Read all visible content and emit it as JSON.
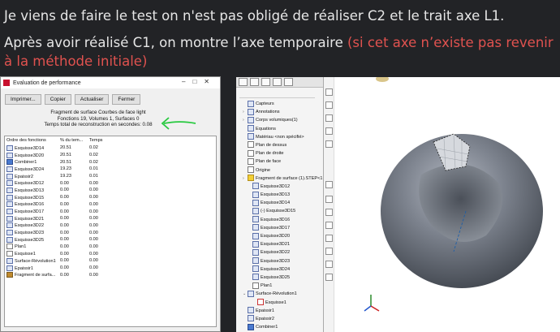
{
  "text": {
    "line1": "Je viens de faire le test on n'est pas obligé de réaliser C2 et le trait axe L1.",
    "line2_prefix": "Après avoir réalisé C1, on montre l’axe temporaire ",
    "line2_red": "(si cet axe n’existe pas revenir à la méthode initiale)"
  },
  "colors": {
    "background": "#222326",
    "red_text": "#e0524f",
    "surface": "#6d7480"
  },
  "perf_window": {
    "title": "Evaluation de performance",
    "buttons": [
      "Imprimer...",
      "Copier",
      "Actualiser",
      "Fermer"
    ],
    "info": [
      "Fragment de surface Courbes de face light",
      "Fonctions 19, Volumes 1, Surfaces 0",
      "Temps total de reconstruction en secondes: 0.08"
    ],
    "columns": [
      "Ordre des fonctions",
      "% du tem...",
      "Temps"
    ],
    "rows": [
      {
        "name": "Esquisse3D14",
        "pct": "20.51",
        "time": "0.02",
        "icon": "sketch"
      },
      {
        "name": "Esquisse3D20",
        "pct": "20.51",
        "time": "0.02",
        "icon": "sketch"
      },
      {
        "name": "Combiner1",
        "pct": "20.51",
        "time": "0.02",
        "icon": "combine"
      },
      {
        "name": "Esquisse3D24",
        "pct": "19.23",
        "time": "0.01",
        "icon": "sketch"
      },
      {
        "name": "Epaissir2",
        "pct": "19.23",
        "time": "0.01",
        "icon": "sketch"
      },
      {
        "name": "Esquisse3D12",
        "pct": "0.00",
        "time": "0.00",
        "icon": "sketch"
      },
      {
        "name": "Esquisse3D13",
        "pct": "0.00",
        "time": "0.00",
        "icon": "sketch"
      },
      {
        "name": "Esquisse3D15",
        "pct": "0.00",
        "time": "0.00",
        "icon": "sketch"
      },
      {
        "name": "Esquisse3D16",
        "pct": "0.00",
        "time": "0.00",
        "icon": "sketch"
      },
      {
        "name": "Esquisse3D17",
        "pct": "0.00",
        "time": "0.00",
        "icon": "sketch"
      },
      {
        "name": "Esquisse3D21",
        "pct": "0.00",
        "time": "0.00",
        "icon": "sketch"
      },
      {
        "name": "Esquisse3D22",
        "pct": "0.00",
        "time": "0.00",
        "icon": "sketch"
      },
      {
        "name": "Esquisse3D23",
        "pct": "0.00",
        "time": "0.00",
        "icon": "sketch"
      },
      {
        "name": "Esquisse3D25",
        "pct": "0.00",
        "time": "0.00",
        "icon": "sketch"
      },
      {
        "name": "Plan1",
        "pct": "0.00",
        "time": "0.00",
        "icon": "plane"
      },
      {
        "name": "Esquisse1",
        "pct": "0.00",
        "time": "0.00",
        "icon": "plane"
      },
      {
        "name": "Surface-Révolution1",
        "pct": "0.00",
        "time": "0.00",
        "icon": "sketch"
      },
      {
        "name": "Epaissir1",
        "pct": "0.00",
        "time": "0.00",
        "icon": "sketch"
      },
      {
        "name": "Fragment de surfa...",
        "pct": "0.00",
        "time": "0.00",
        "icon": "surface"
      }
    ]
  },
  "feature_tree": {
    "items": [
      {
        "label": "Capteurs",
        "icon": "sketch",
        "indent": 1,
        "arrow": ""
      },
      {
        "label": "Annotations",
        "icon": "sketch",
        "indent": 1,
        "arrow": "›"
      },
      {
        "label": "Corps volumiques(1)",
        "icon": "sketch",
        "indent": 1,
        "arrow": "›"
      },
      {
        "label": "Equations",
        "icon": "sketch",
        "indent": 1,
        "arrow": ""
      },
      {
        "label": "Matériau <non spécifié>",
        "icon": "sketch",
        "indent": 1,
        "arrow": ""
      },
      {
        "label": "Plan de dessus",
        "icon": "plane",
        "indent": 1,
        "arrow": ""
      },
      {
        "label": "Plan de droite",
        "icon": "plane",
        "indent": 1,
        "arrow": ""
      },
      {
        "label": "Plan de face",
        "icon": "plane",
        "indent": 1,
        "arrow": ""
      },
      {
        "label": "Origine",
        "icon": "plane",
        "indent": 1,
        "arrow": ""
      },
      {
        "label": "Fragment de surface (1).STEP<1",
        "icon": "yellow",
        "indent": 1,
        "arrow": "›"
      },
      {
        "label": "Esquisse3D12",
        "icon": "sketch",
        "indent": 2,
        "arrow": ""
      },
      {
        "label": "Esquisse3D13",
        "icon": "sketch",
        "indent": 2,
        "arrow": ""
      },
      {
        "label": "Esquisse3D14",
        "icon": "sketch",
        "indent": 2,
        "arrow": ""
      },
      {
        "label": "(-) Esquisse3D15",
        "icon": "sketch",
        "indent": 2,
        "arrow": ""
      },
      {
        "label": "Esquisse3D16",
        "icon": "sketch",
        "indent": 2,
        "arrow": ""
      },
      {
        "label": "Esquisse3D17",
        "icon": "sketch",
        "indent": 2,
        "arrow": ""
      },
      {
        "label": "Esquisse3D20",
        "icon": "sketch",
        "indent": 2,
        "arrow": ""
      },
      {
        "label": "Esquisse3D21",
        "icon": "sketch",
        "indent": 2,
        "arrow": ""
      },
      {
        "label": "Esquisse3D22",
        "icon": "sketch",
        "indent": 2,
        "arrow": ""
      },
      {
        "label": "Esquisse3D23",
        "icon": "sketch",
        "indent": 2,
        "arrow": ""
      },
      {
        "label": "Esquisse3D24",
        "icon": "sketch",
        "indent": 2,
        "arrow": ""
      },
      {
        "label": "Esquisse3D25",
        "icon": "sketch",
        "indent": 2,
        "arrow": ""
      },
      {
        "label": "Plan1",
        "icon": "plane",
        "indent": 2,
        "arrow": ""
      },
      {
        "label": "Surface-Révolution1",
        "icon": "sketch",
        "indent": 1,
        "arrow": "⌄"
      },
      {
        "label": "Esquisse1",
        "icon": "red",
        "indent": 3,
        "arrow": ""
      },
      {
        "label": "Epaissir1",
        "icon": "sketch",
        "indent": 1,
        "arrow": ""
      },
      {
        "label": "Epaissir2",
        "icon": "sketch",
        "indent": 1,
        "arrow": ""
      },
      {
        "label": "Combiner1",
        "icon": "blue",
        "indent": 1,
        "arrow": ""
      }
    ]
  }
}
